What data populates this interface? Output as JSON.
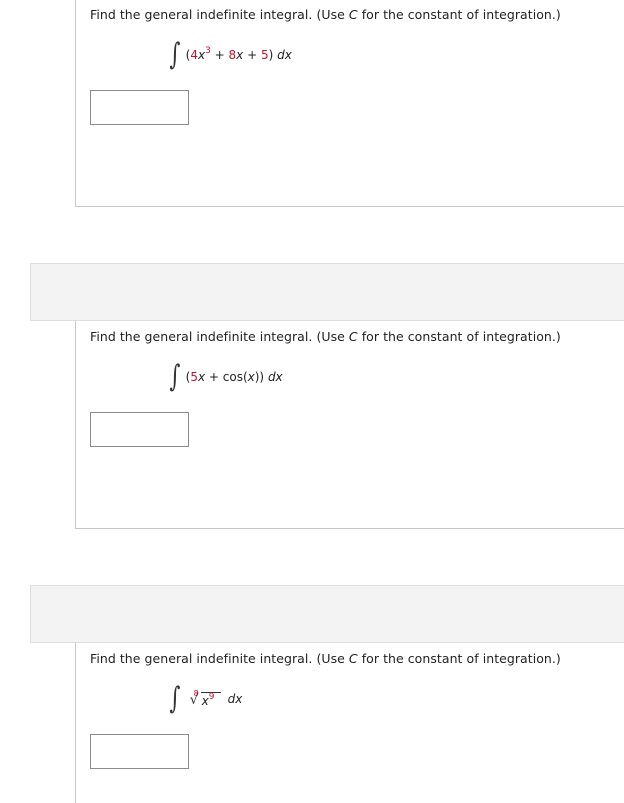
{
  "problems": [
    {
      "instruction_prefix": "Find the general indefinite integral. (Use ",
      "constant_symbol": "C",
      "instruction_suffix": " for the constant of integration.)",
      "integral_sign": "∫",
      "expression": {
        "open": "(",
        "coef1": "4",
        "var1": "x",
        "exp1": "3",
        "plus1": " + ",
        "coef2": "8",
        "var2": "x",
        "plus2": " + ",
        "const": "5",
        "close": ")",
        "differential": " dx"
      },
      "answer_value": ""
    },
    {
      "instruction_prefix": "Find the general indefinite integral. (Use ",
      "constant_symbol": "C",
      "instruction_suffix": " for the constant of integration.)",
      "integral_sign": "∫",
      "expression": {
        "open": "(",
        "coef1": "5",
        "var1": "x",
        "plus1": " + cos(",
        "var2": "x",
        "close": "))",
        "differential": " dx"
      },
      "answer_value": ""
    },
    {
      "instruction_prefix": "Find the general indefinite integral. (Use ",
      "constant_symbol": "C",
      "instruction_suffix": " for the constant of integration.)",
      "integral_sign": "∫",
      "expression": {
        "root_index": "8",
        "radical_symbol": "√",
        "var": "x",
        "exp": "9",
        "differential": "dx"
      },
      "answer_value": ""
    }
  ],
  "colors": {
    "coefficient_red": "#c8102e",
    "panel_border": "#c8c8c8",
    "separator_bg": "#f3f3f3"
  }
}
